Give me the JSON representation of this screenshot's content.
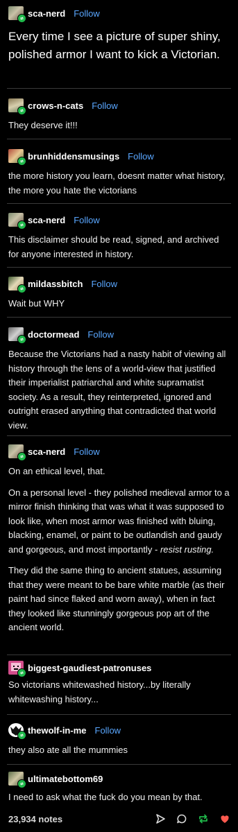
{
  "follow_label": "Follow",
  "colors": {
    "background": "#000000",
    "link_blue": "#5aa7ff",
    "reblog_green": "#1fb84a",
    "like_red": "#ff5a4f"
  },
  "posts": [
    {
      "username": "sca-nerd",
      "show_follow": true,
      "paragraphs": [
        "Every time I see a picture of super shiny, polished armor I want to kick a Victorian."
      ]
    },
    {
      "username": "crows-n-cats",
      "show_follow": true,
      "paragraphs": [
        "They deserve it!!!"
      ]
    },
    {
      "username": "brunhiddensmusings",
      "show_follow": true,
      "paragraphs": [
        "the more history  you learn, doesnt matter what history, the more you hate the victorians"
      ]
    },
    {
      "username": "sca-nerd",
      "show_follow": true,
      "paragraphs": [
        "This disclaimer should be read, signed, and archived for anyone interested in history."
      ]
    },
    {
      "username": "mildassbitch",
      "show_follow": true,
      "paragraphs": [
        "Wait but WHY"
      ]
    },
    {
      "username": "doctormead",
      "show_follow": true,
      "paragraphs": [
        "Because the Victorians had a nasty habit of viewing all history through the lens of a world-view that justified their imperialist patriarchal and white supramatist society.  As a result, they reinterpreted, ignored and outright erased anything that contradicted that world view."
      ]
    },
    {
      "username": "sca-nerd",
      "show_follow": true,
      "paragraphs": [
        "On an ethical level, that.",
        "On a personal level - they polished medieval armor to a mirror finish thinking that was what it was supposed to look like, when most armor was finished with bluing, blacking, enamel, or paint to be outlandish and gaudy and gorgeous, and most importantly - ",
        "They did the same thing to ancient statues, assuming that they were meant to be bare white marble (as their paint had since flaked and worn away), when in fact they looked like stunningly gorgeous pop art of the ancient world."
      ],
      "italic_tail": "resist rusting."
    },
    {
      "username": "biggest-gaudiest-patronuses",
      "show_follow": false,
      "paragraphs": [
        "So victorians whitewashed history...by literally whitewashing history..."
      ]
    },
    {
      "username": "thewolf-in-me",
      "show_follow": true,
      "paragraphs": [
        "they also ate all the mummies"
      ]
    },
    {
      "username": "ultimatebottom69",
      "show_follow": false,
      "paragraphs": [
        "I need to ask what the fuck do you mean by that."
      ]
    }
  ],
  "footer": {
    "notes": "23,934 notes",
    "icons": [
      "share-icon",
      "reply-icon",
      "reblog-icon",
      "like-icon"
    ]
  }
}
